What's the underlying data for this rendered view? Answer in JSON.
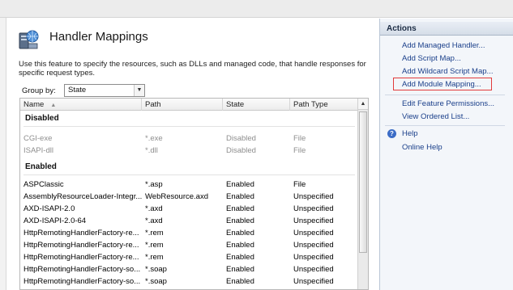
{
  "feature": {
    "icon": "server-globe-icon",
    "title": "Handler Mappings",
    "description": "Use this feature to specify the resources, such as DLLs and managed code, that handle responses for specific request types."
  },
  "group_by": {
    "label": "Group by:",
    "value": "State"
  },
  "grid": {
    "columns": [
      "Name",
      "Path",
      "State",
      "Path Type"
    ],
    "groups": [
      {
        "title": "Disabled",
        "rows": [
          {
            "name": "CGI-exe",
            "path": "*.exe",
            "state": "Disabled",
            "path_type": "File"
          },
          {
            "name": "ISAPI-dll",
            "path": "*.dll",
            "state": "Disabled",
            "path_type": "File"
          }
        ]
      },
      {
        "title": "Enabled",
        "rows": [
          {
            "name": "ASPClassic",
            "path": "*.asp",
            "state": "Enabled",
            "path_type": "File"
          },
          {
            "name": "AssemblyResourceLoader-Integr...",
            "path": "WebResource.axd",
            "state": "Enabled",
            "path_type": "Unspecified"
          },
          {
            "name": "AXD-ISAPI-2.0",
            "path": "*.axd",
            "state": "Enabled",
            "path_type": "Unspecified"
          },
          {
            "name": "AXD-ISAPI-2.0-64",
            "path": "*.axd",
            "state": "Enabled",
            "path_type": "Unspecified"
          },
          {
            "name": "HttpRemotingHandlerFactory-re...",
            "path": "*.rem",
            "state": "Enabled",
            "path_type": "Unspecified"
          },
          {
            "name": "HttpRemotingHandlerFactory-re...",
            "path": "*.rem",
            "state": "Enabled",
            "path_type": "Unspecified"
          },
          {
            "name": "HttpRemotingHandlerFactory-re...",
            "path": "*.rem",
            "state": "Enabled",
            "path_type": "Unspecified"
          },
          {
            "name": "HttpRemotingHandlerFactory-so...",
            "path": "*.soap",
            "state": "Enabled",
            "path_type": "Unspecified"
          },
          {
            "name": "HttpRemotingHandlerFactory-so...",
            "path": "*.soap",
            "state": "Enabled",
            "path_type": "Unspecified"
          }
        ]
      }
    ]
  },
  "actions": {
    "title": "Actions",
    "items": [
      {
        "label": "Add Managed Handler..."
      },
      {
        "label": "Add Script Map..."
      },
      {
        "label": "Add Wildcard Script Map..."
      },
      {
        "label": "Add Module Mapping..."
      },
      {
        "label": "Edit Feature Permissions..."
      },
      {
        "label": "View Ordered List..."
      },
      {
        "label": "Help"
      },
      {
        "label": "Online Help"
      }
    ],
    "highlighted": "Add Module Mapping...",
    "help_icon": "help-icon"
  },
  "colors": {
    "link": "#1a3f8a",
    "highlight_border": "#e23b3b",
    "disabled_text": "#8e8e8e",
    "actions_bg": "#f3f6fa"
  }
}
